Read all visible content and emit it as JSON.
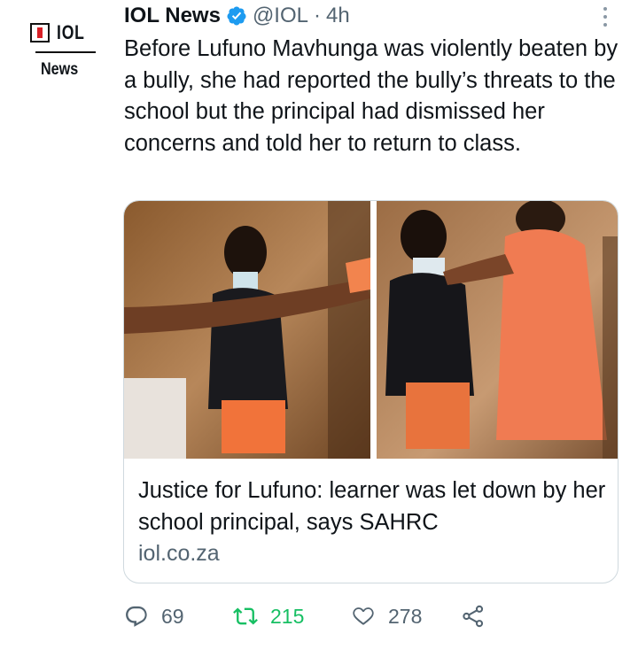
{
  "account": {
    "logo_text": "IOL",
    "logo_subtext": "News",
    "display_name": "IOL News",
    "handle": "@IOL",
    "separator": "·",
    "time": "4h"
  },
  "tweet": {
    "text": "Before Lufuno Mavhunga was violently beaten by a bully, she had reported the bully’s threats to the school but the principal had dismissed her concerns and told her to return to class."
  },
  "card": {
    "title": "Justice for Lufuno: learner was let down by her school principal, says SAHRC",
    "domain": "iol.co.za"
  },
  "actions": {
    "replies": "69",
    "retweets": "215",
    "likes": "278"
  },
  "colors": {
    "text": "#0f1419",
    "secondary": "#536471",
    "verified": "#1d9bf0",
    "retweet_active": "#17bf63",
    "logo_red": "#d81f26"
  },
  "icons": [
    "verified-badge-icon",
    "more-icon",
    "reply-icon",
    "retweet-icon",
    "like-icon",
    "share-icon"
  ]
}
